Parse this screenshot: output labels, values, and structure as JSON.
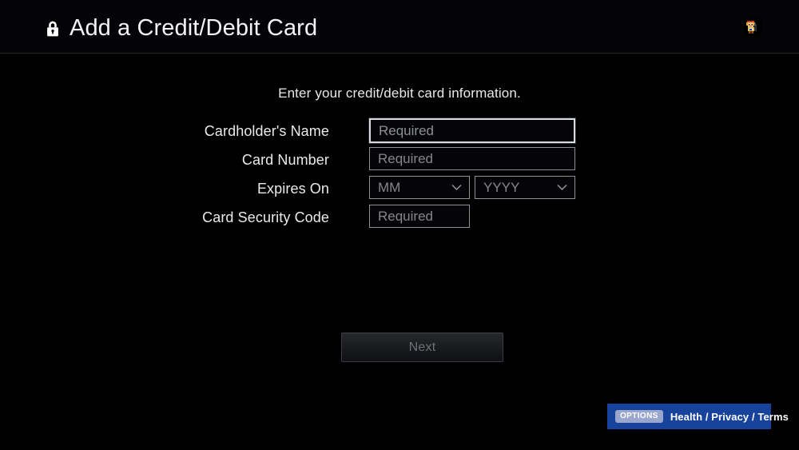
{
  "header": {
    "title": "Add a Credit/Debit Card",
    "lock_icon": "lock-icon",
    "avatar_icon": "user-avatar"
  },
  "main": {
    "subtitle": "Enter your credit/debit card information.",
    "fields": [
      {
        "label": "Cardholder's Name",
        "placeholder": "Required",
        "value": "",
        "focused": true,
        "type": "text"
      },
      {
        "label": "Card Number",
        "placeholder": "Required",
        "value": "",
        "focused": false,
        "type": "text"
      },
      {
        "label": "Expires On",
        "month_placeholder": "MM",
        "year_placeholder": "YYYY",
        "month_value": "MM",
        "year_value": "YYYY",
        "focused": false,
        "type": "date-select"
      },
      {
        "label": "Card Security Code",
        "placeholder": "Required",
        "value": "",
        "focused": false,
        "type": "text"
      }
    ],
    "next_label": "Next",
    "next_disabled": true
  },
  "footer": {
    "options_chip": "OPTIONS",
    "options_text": "Health / Privacy / Terms"
  },
  "colors": {
    "background": "#000000",
    "header_background": "#040406",
    "text_primary": "#e9eaec",
    "text_placeholder": "#86888d",
    "field_border": "#8d9095",
    "field_border_focused": "#d9dcdf",
    "accent_blue": "#17439c",
    "chip_blue": "#9aa6cb",
    "next_text": "#6e7176"
  }
}
